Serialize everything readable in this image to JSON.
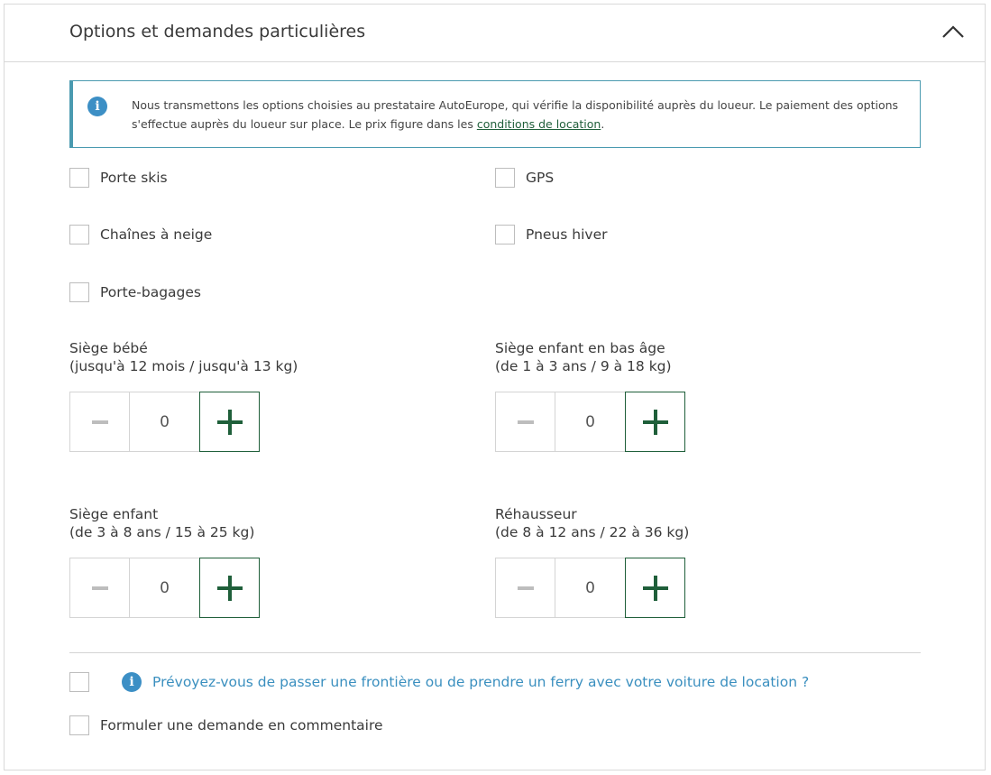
{
  "header": {
    "title": "Options et demandes particulières"
  },
  "info": {
    "text_before": "Nous transmettons les options choisies au prestataire AutoEurope, qui vérifie la disponibilité auprès du loueur. Le paiement des options s'effectue auprès du loueur sur place. Le prix figure dans les ",
    "link": "conditions de location",
    "text_after": "."
  },
  "options": [
    {
      "label": "Porte skis",
      "checked": false
    },
    {
      "label": "GPS",
      "checked": false
    },
    {
      "label": "Chaînes à neige",
      "checked": false
    },
    {
      "label": "Pneus hiver",
      "checked": false
    },
    {
      "label": "Porte-bagages",
      "checked": false
    }
  ],
  "seats": [
    {
      "title": "Siège bébé",
      "detail": "(jusqu'à 12 mois / jusqu'à 13 kg)",
      "value": "0"
    },
    {
      "title": "Siège enfant en bas âge",
      "detail": "(de 1 à 3 ans / 9 à 18 kg)",
      "value": "0"
    },
    {
      "title": "Siège enfant",
      "detail": "(de 3 à 8 ans / 15 à 25 kg)",
      "value": "0"
    },
    {
      "title": "Réhausseur",
      "detail": "(de 8 à 12 ans / 22 à 36 kg)",
      "value": "0"
    }
  ],
  "extra": {
    "border_question": "Prévoyez-vous de passer une frontière ou de prendre un ferry avec votre voiture de location ?",
    "comment_label": "Formuler une demande en commentaire"
  },
  "colors": {
    "accent_green": "#1f5f3a",
    "info_blue": "#3c8fc5",
    "link_blue": "#3a8fbf",
    "border_teal": "#4a9ab0"
  }
}
